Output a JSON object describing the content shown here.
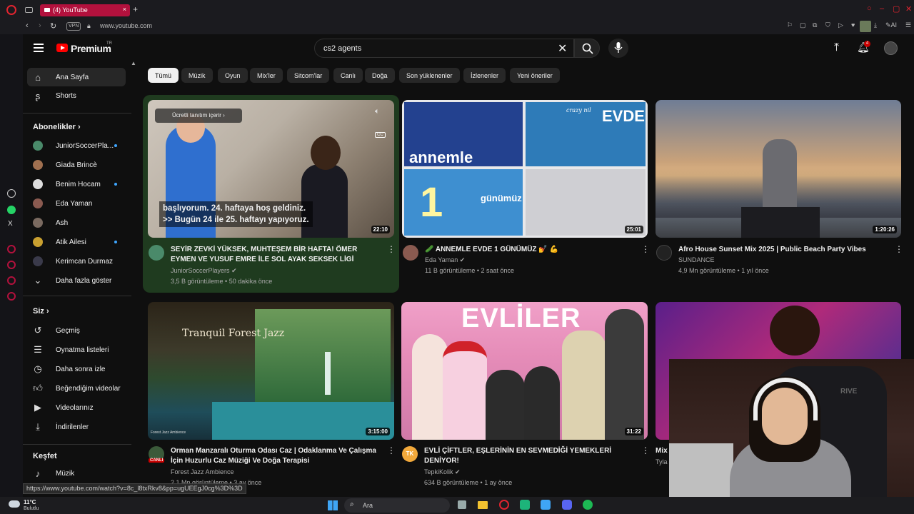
{
  "browser": {
    "tab_title": "(4) YouTube",
    "url": "www.youtube.com",
    "vpn_label": "VPN",
    "ai_label": "AI"
  },
  "header": {
    "logo_text": "Premium",
    "logo_sup": "TR",
    "search_value": "cs2 agents",
    "notif_count": "4"
  },
  "sidebar": {
    "main": [
      {
        "label": "Ana Sayfa",
        "icon": "home-icon"
      },
      {
        "label": "Shorts",
        "icon": "shorts-icon"
      }
    ],
    "subs_heading": "Abonelikler",
    "subs": [
      {
        "label": "JuniorSoccerPla...",
        "dot": true,
        "color": "#4a8a6a"
      },
      {
        "label": "Giada Brincè",
        "dot": false,
        "color": "#a07050"
      },
      {
        "label": "Benim Hocam",
        "dot": true,
        "color": "#dddddd"
      },
      {
        "label": "Eda Yaman",
        "dot": false,
        "color": "#8a5a50"
      },
      {
        "label": "Ash",
        "dot": false,
        "color": "#7a6a60"
      },
      {
        "label": "Atik Ailesi",
        "dot": true,
        "color": "#c9a030"
      },
      {
        "label": "Kerimcan Durmaz",
        "dot": false,
        "color": "#3a3a4a"
      }
    ],
    "more_label": "Daha fazla göster",
    "you_heading": "Siz",
    "you_items": [
      {
        "label": "Geçmiş",
        "icon": "history-icon"
      },
      {
        "label": "Oynatma listeleri",
        "icon": "playlist-icon"
      },
      {
        "label": "Daha sonra izle",
        "icon": "watch-later-icon"
      },
      {
        "label": "Beğendiğim videolar",
        "icon": "like-icon"
      },
      {
        "label": "Videolarınız",
        "icon": "your-videos-icon"
      },
      {
        "label": "İndirilenler",
        "icon": "download-icon"
      }
    ],
    "explore_heading": "Keşfet",
    "explore_items": [
      {
        "label": "Müzik",
        "icon": "music-icon"
      }
    ]
  },
  "chips": [
    "Tümü",
    "Müzik",
    "Oyun",
    "Mix'ler",
    "Sitcom'lar",
    "Canlı",
    "Doğa",
    "Son yüklenenler",
    "İzlenenler",
    "Yeni öneriler"
  ],
  "videos": [
    {
      "title_line1": "SEYİR ZEVKİ YÜKSEK, MUHTEŞEM BİR HAFTA! ÖMER",
      "title_line2": "EYMEN VE YUSUF EMRE İLE SOL AYAK SEKSEK LİGİ",
      "channel": "JuniorSoccerPlayers",
      "meta": "3,5 B görüntüleme • 50 dakika önce",
      "duration": "22:10",
      "promo": "Ücretli tanıtım içerir",
      "caption_line1": "başlıyorum. 24. haftaya hoş geldiniz.",
      "caption_line2": ">> Bugün 24 ile 25. haftayı yapıyoruz.",
      "cc": "CC"
    },
    {
      "title_line1": "🥒 ANNEMLE EVDE 1 GÜNÜMÜZ 💅 💪",
      "title_line2": "",
      "channel": "Eda Yaman",
      "meta": "11 B görüntüleme • 2 saat önce",
      "duration": "25:01",
      "thumb_text_a": "annemle",
      "thumb_text_b": "EVDE",
      "thumb_text_c": "1",
      "thumb_text_d": "günümüz",
      "thumb_text_e": "crazy nil"
    },
    {
      "title_line1": "Afro House Sunset Mix 2025 | Public Beach Party Vibes",
      "title_line2": "",
      "channel": "SUNDANCE",
      "meta": "4,9 Mn görüntüleme • 1 yıl önce",
      "duration": "1:20:26"
    },
    {
      "title_line1": "Orman Manzaralı Oturma Odası Caz | Odaklanma Ve Çalışma",
      "title_line2": "İçin Huzurlu Caz Müziği Ve Doğa Terapisi",
      "channel": "Forest Jazz Ambience",
      "meta": "2,1 Mn görüntüleme • 3 ay önce",
      "duration": "3:15:00",
      "thumb_text": "Tranquil Forest Jazz",
      "thumb_sub": "Forest Jazz Ambience",
      "badge": "CANLI"
    },
    {
      "title_line1": "EVLİ ÇİFTLER, EŞLERİNİN EN SEVMEDİĞİ YEMEKLERİ",
      "title_line2": "DENİYOR!",
      "channel": "TepkiKolik",
      "meta": "634 B görüntüleme • 1 ay önce",
      "duration": "31:22",
      "thumb_text": "EVLİLER",
      "avatar_text": "TK"
    },
    {
      "title_line1": "Mix",
      "channel": "Tyla"
    }
  ],
  "status_url": "https://www.youtube.com/watch?v=8c_l8txRkv8&pp=ugUEEgJ0cg%3D%3D",
  "taskbar": {
    "temp": "11°C",
    "weather": "Bulutlu",
    "search": "Ara"
  },
  "webcam": {
    "chair_text": "RIVE"
  }
}
